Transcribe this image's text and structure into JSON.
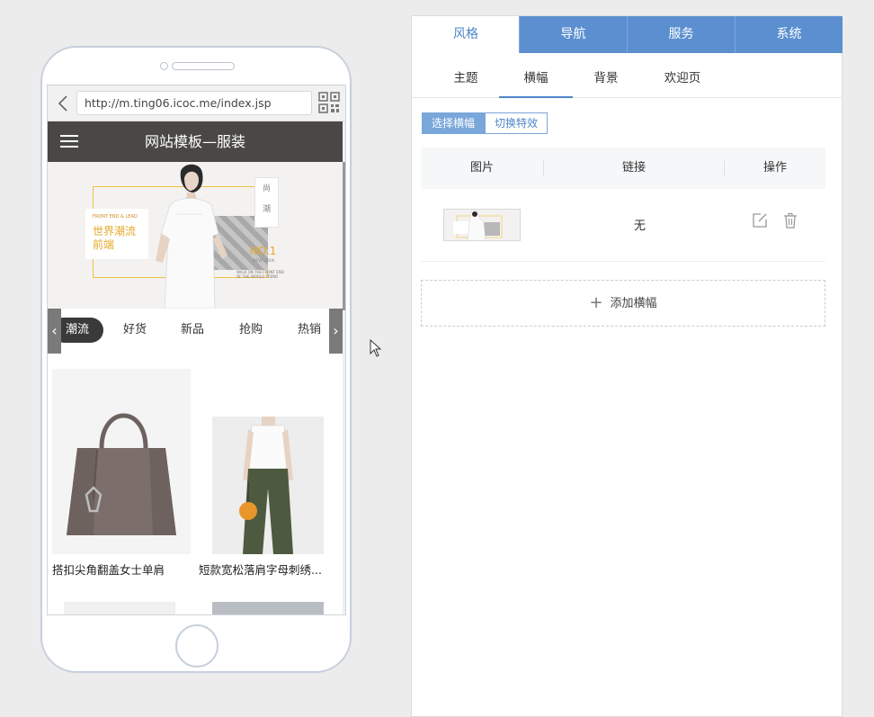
{
  "phone": {
    "url": "http://m.ting06.icoc.me/index.jsp",
    "site_title": "网站模板—服装",
    "banner": {
      "small_text": "FRONT END & LEAD",
      "slogan_line1": "世界潮流",
      "slogan_line2": "前端",
      "badge": "NO.1",
      "lookbook": "NEW LOOK",
      "tiny_line1": "WALK ON THE FRONT END",
      "tiny_line2": "OF THE WORLD TREND",
      "seal_top": "尚",
      "seal_bottom": "潮"
    },
    "categories": [
      "潮流",
      "好货",
      "新品",
      "抢购",
      "热销"
    ],
    "products": [
      {
        "name": "搭扣尖角翻盖女士单肩"
      },
      {
        "name": "短款宽松落肩字母刺绣..."
      }
    ]
  },
  "panel": {
    "main_tabs": [
      "风格",
      "导航",
      "服务",
      "系统"
    ],
    "sub_tabs": [
      "主题",
      "横幅",
      "背景",
      "欢迎页"
    ],
    "segment": [
      "选择横幅",
      "切换特效"
    ],
    "table": {
      "headers": [
        "图片",
        "链接",
        "操作"
      ],
      "rows": [
        {
          "link": "无"
        }
      ]
    },
    "add_banner_label": "添加横幅"
  },
  "colors": {
    "accent": "#5b8fd0",
    "header_dark": "#4a4846",
    "banner_gold": "#e6a82a"
  }
}
